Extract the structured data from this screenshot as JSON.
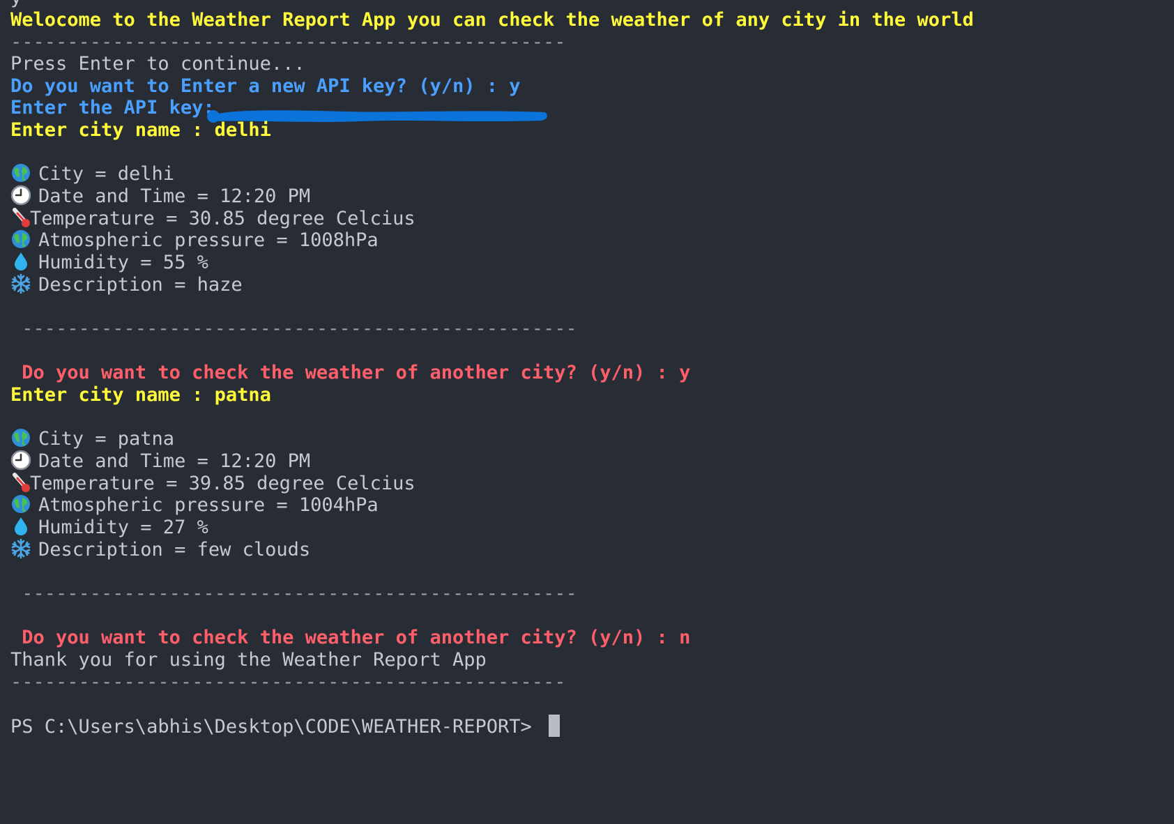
{
  "terminal": {
    "top_char": "y",
    "welcome": "Welocome to the Weather Report App you can check the weather of any city in the world",
    "separator": "-------------------------------------------------",
    "separator_indented": " -------------------------------------------------",
    "press_enter": "Press Enter to continue...",
    "api_prompt": "Do you want to Enter a new API key? (y/n) : y",
    "api_key_label": "Enter the API key: ",
    "entries": [
      {
        "city_prompt": "Enter city name : delhi",
        "city": "City = delhi",
        "datetime": "Date and Time = 12:20 PM",
        "temperature": "Temperature = 30.85 degree Celcius",
        "pressure": "Atmospheric pressure = 1008hPa",
        "humidity": "Humidity = 55 %",
        "description": "Description = haze",
        "again_prompt": " Do you want to check the weather of another city? (y/n) : y"
      },
      {
        "city_prompt": "Enter city name : patna",
        "city": "City = patna",
        "datetime": "Date and Time = 12:20 PM",
        "temperature": "Temperature = 39.85 degree Celcius",
        "pressure": "Atmospheric pressure = 1004hPa",
        "humidity": "Humidity = 27 %",
        "description": "Description = few clouds",
        "again_prompt": " Do you want to check the weather of another city? (y/n) : n"
      }
    ],
    "thanks": "Thank you for using the Weather Report App",
    "shell_prompt": "PS C:\\Users\\abhis\\Desktop\\CODE\\WEATHER-REPORT> "
  },
  "icons": {
    "city": "globe-icon",
    "datetime": "clock-icon",
    "temperature": "thermometer-icon",
    "pressure": "globe-icon",
    "humidity": "droplet-icon",
    "description": "snowflake-icon"
  },
  "colors": {
    "background": "#282c34",
    "yellow": "#fffb3a",
    "blue": "#4aa0ff",
    "red": "#ff5f6b",
    "gray": "#c7c9cf",
    "redaction": "#0a74da"
  }
}
